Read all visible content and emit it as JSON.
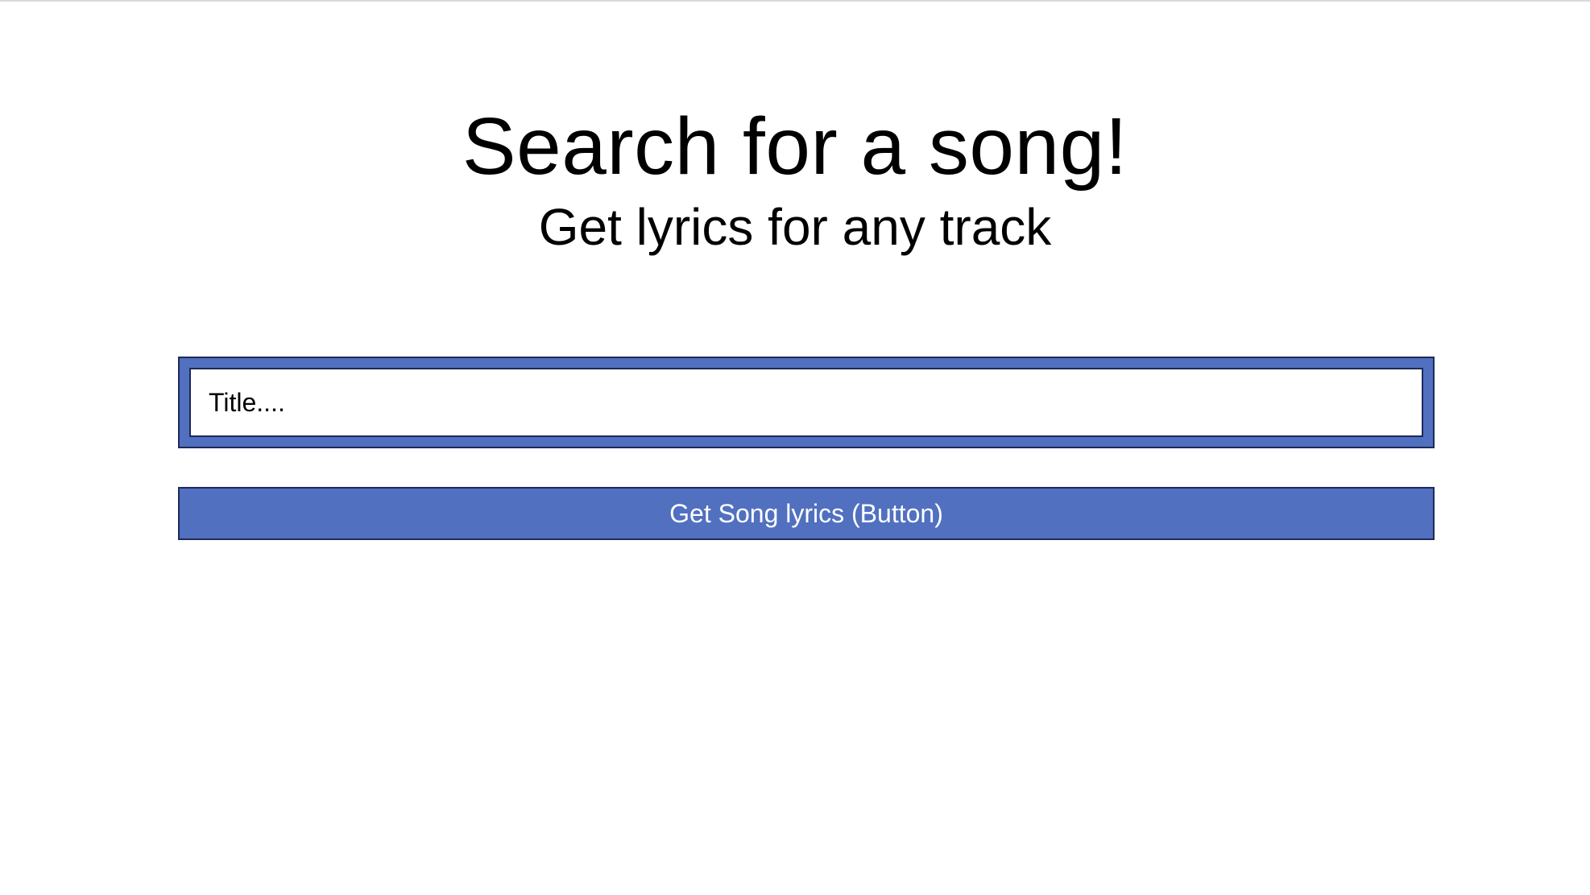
{
  "header": {
    "title": "Search for a song!",
    "subtitle": "Get lyrics for any track"
  },
  "search": {
    "placeholder": "Title....",
    "value": ""
  },
  "actions": {
    "get_lyrics_label": "Get Song lyrics (Button)"
  },
  "colors": {
    "accent": "#5170c0",
    "border": "#1e2a5a",
    "background": "#ffffff",
    "text": "#000000",
    "button_text": "#ffffff"
  }
}
